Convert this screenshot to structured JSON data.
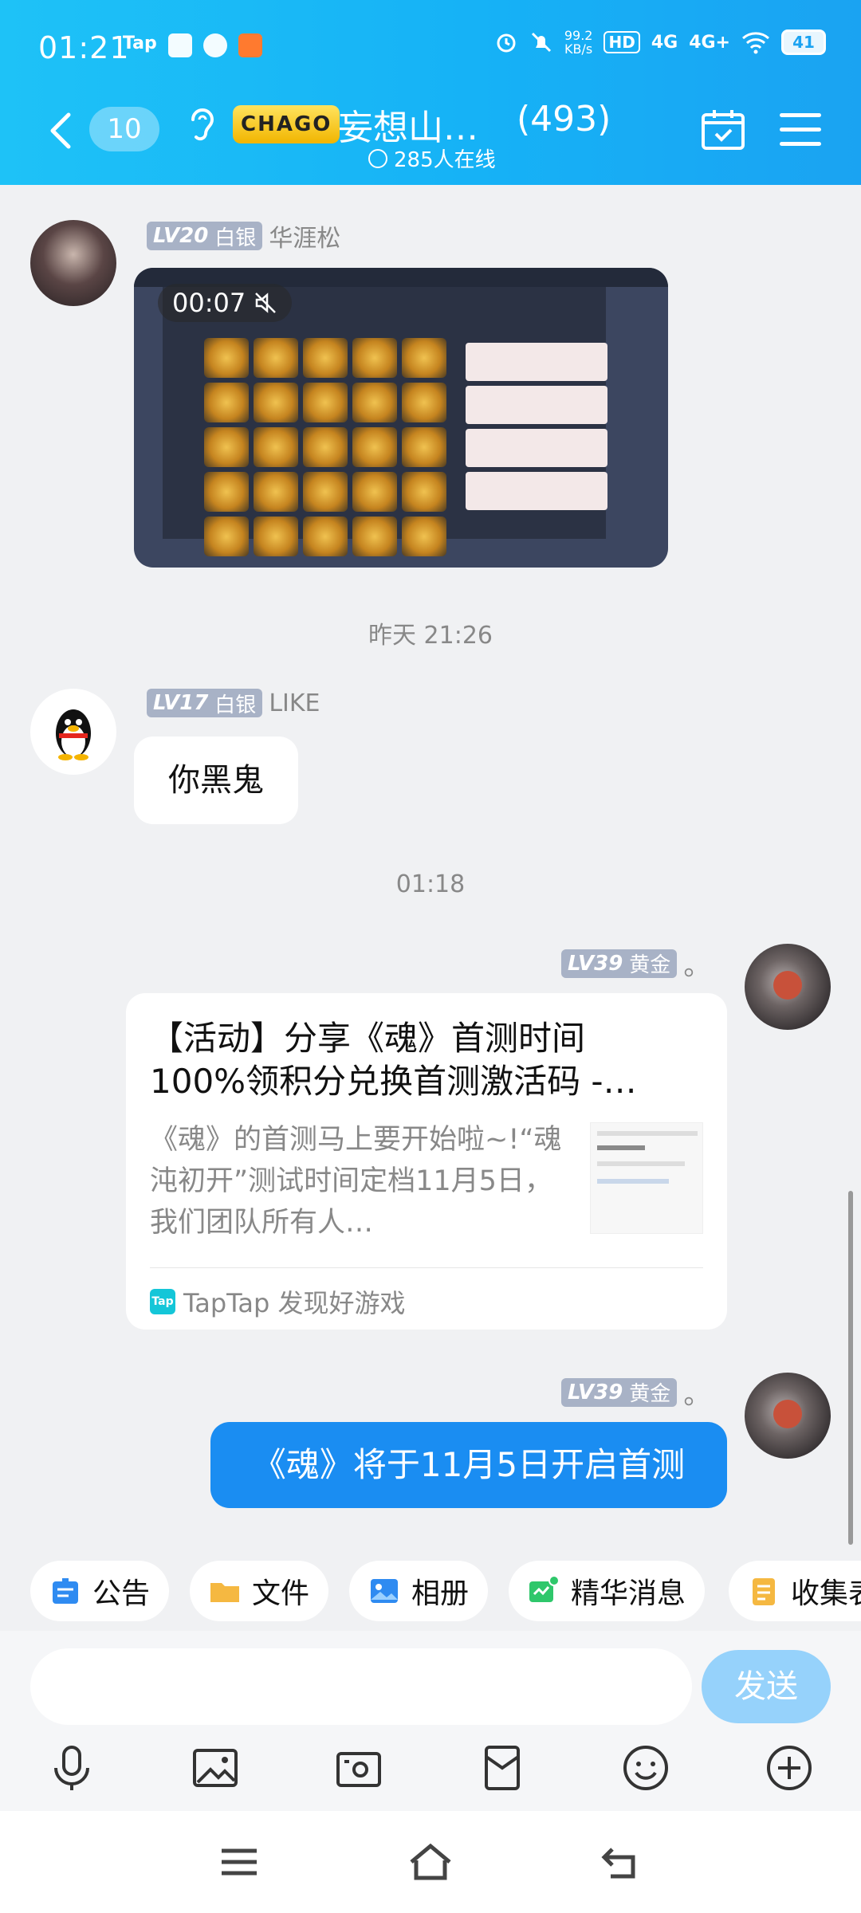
{
  "status_bar": {
    "time": "01:21",
    "tap_label": "Tap",
    "speed_value": "99.2",
    "speed_unit": "KB/s",
    "hd_label": "HD",
    "net1": "4G",
    "net2": "4G+",
    "battery": "41"
  },
  "header": {
    "back_count": "10",
    "logo_text": "CHAGO",
    "group_title": "妄想山…",
    "member_count": "(493)",
    "online": "285人在线"
  },
  "messages": {
    "m1": {
      "level": "LV20",
      "rank": "白银",
      "name": "华涯松",
      "video_time": "00:07"
    },
    "ts1": "昨天 21:26",
    "m2": {
      "level": "LV17",
      "rank": "白银",
      "name": "LIKE",
      "text": "你黑鬼"
    },
    "ts2": "01:18",
    "m3": {
      "level": "LV39",
      "rank": "黄金",
      "suffix": "。",
      "card_title": "【活动】分享《魂》首测时间100%领积分兑换首测激活码 -…",
      "card_desc": "《魂》的首测马上要开始啦~!“魂沌初开”测试时间定档11月5日，我们团队所有人…",
      "card_source": "TapTap 发现好游戏",
      "card_source_logo": "Tap"
    },
    "m4": {
      "level": "LV39",
      "rank": "黄金",
      "suffix": "。",
      "text": "《魂》将于11月5日开启首测"
    }
  },
  "quick_actions": [
    {
      "label": "公告",
      "icon": "announcement-icon",
      "color": "#2f8bf1"
    },
    {
      "label": "文件",
      "icon": "folder-icon",
      "color": "#f5b841"
    },
    {
      "label": "相册",
      "icon": "album-icon",
      "color": "#2f8bf1"
    },
    {
      "label": "精华消息",
      "icon": "essence-icon",
      "color": "#2fc76b"
    },
    {
      "label": "收集表",
      "icon": "form-icon",
      "color": "#f5b841"
    }
  ],
  "composer": {
    "placeholder": "",
    "send_label": "发送"
  }
}
